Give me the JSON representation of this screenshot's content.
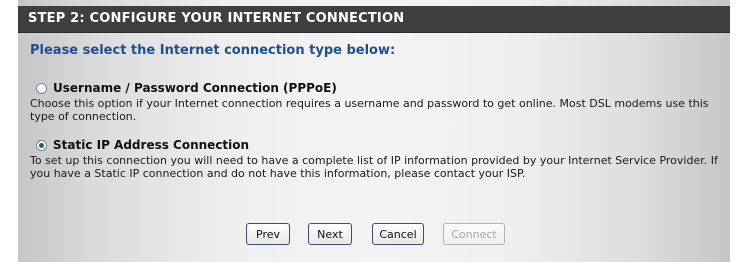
{
  "header": {
    "title": "STEP 2: CONFIGURE YOUR INTERNET CONNECTION"
  },
  "prompt": "Please select the Internet connection type below:",
  "options": [
    {
      "label": "Username / Password Connection (PPPoE)",
      "description": "Choose this option if your Internet connection requires a username and password to get online. Most DSL modems use this type of connection.",
      "selected": false
    },
    {
      "label": "Static IP Address Connection",
      "description": "To set up this connection you will need to have a complete list of IP information provided by your Internet Service Provider. If you have a Static IP connection and do not have this information, please contact your ISP.",
      "selected": true
    }
  ],
  "buttons": {
    "prev": "Prev",
    "next": "Next",
    "cancel": "Cancel",
    "connect": "Connect"
  }
}
